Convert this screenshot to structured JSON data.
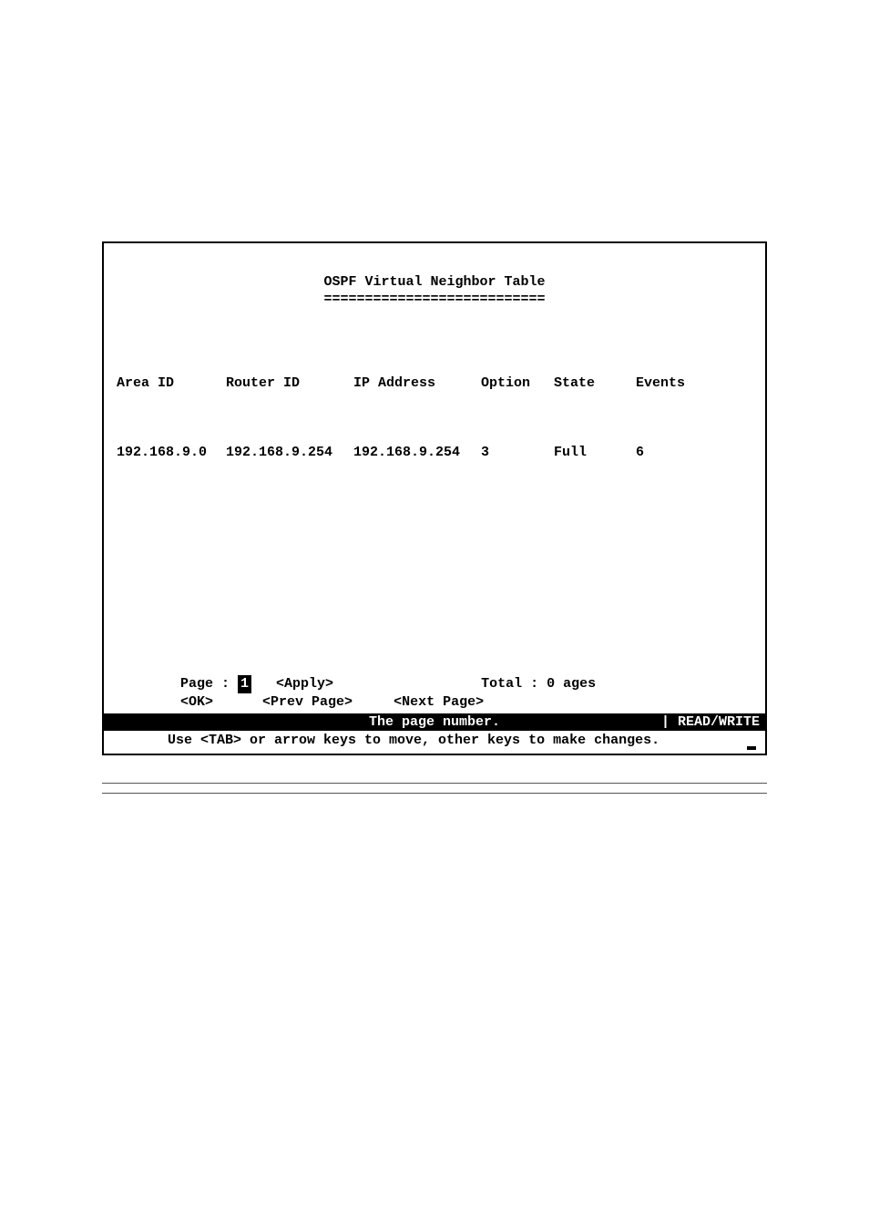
{
  "title": "OSPF Virtual Neighbor Table",
  "title_underline": "===========================",
  "columns": {
    "area": "Area ID",
    "router": "Router ID",
    "ip": "IP Address",
    "option": "Option",
    "state": "State",
    "events": "Events"
  },
  "rows": [
    {
      "area": "192.168.9.0",
      "router": "192.168.9.254",
      "ip": "192.168.9.254",
      "option": "3",
      "state": "Full",
      "events": "6"
    }
  ],
  "nav": {
    "page_label": "Page : ",
    "page_value": "1",
    "apply": "<Apply>",
    "total": "Total : 0 ages",
    "ok": "<OK>",
    "prev": "<Prev Page>",
    "next": "<Next Page>"
  },
  "status": {
    "center": "The page number.",
    "right": "| READ/WRITE"
  },
  "help": "Use <TAB> or arrow keys to move, other keys to make changes."
}
